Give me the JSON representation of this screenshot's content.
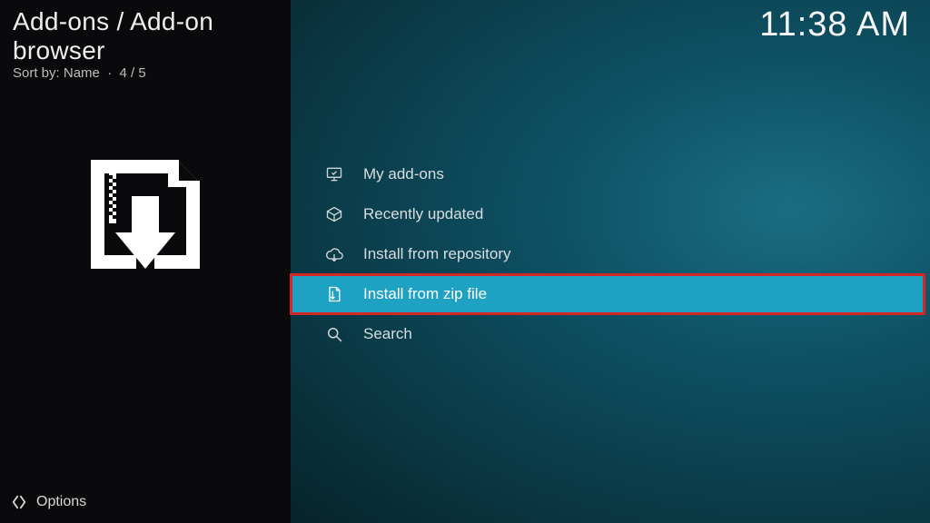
{
  "header": {
    "breadcrumb": "Add-ons / Add-on browser",
    "sort_prefix": "Sort by:",
    "sort_value": "Name",
    "count": "4 / 5"
  },
  "clock": "11:38 AM",
  "menu": {
    "items": [
      {
        "label": "My add-ons",
        "icon": "monitor-icon",
        "selected": false
      },
      {
        "label": "Recently updated",
        "icon": "box-icon",
        "selected": false
      },
      {
        "label": "Install from repository",
        "icon": "cloud-icon",
        "selected": false
      },
      {
        "label": "Install from zip file",
        "icon": "zip-icon",
        "selected": true
      },
      {
        "label": "Search",
        "icon": "search-icon",
        "selected": false
      }
    ]
  },
  "options": {
    "label": "Options"
  },
  "colors": {
    "accent": "#1ea2c4",
    "callout": "#d32626"
  }
}
